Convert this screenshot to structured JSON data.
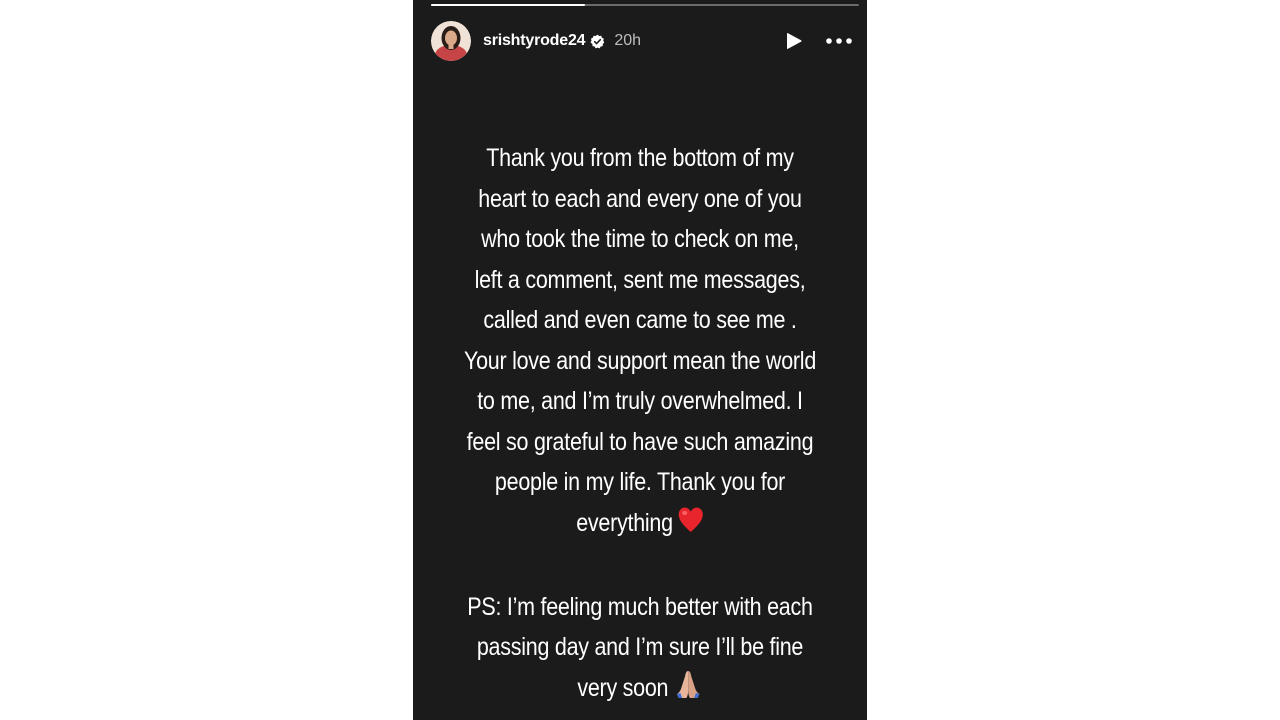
{
  "story": {
    "progress": 0.36,
    "username": "srishtyrode24",
    "timestamp": "20h",
    "verified": true,
    "message_lines": [
      "Thank you from the bottom of my",
      "heart to each and every one of you",
      "who took the time to check on me,",
      "left a comment, sent me messages,",
      "called and even came to see me .",
      "Your love and support mean the world",
      "to me, and I’m truly overwhelmed. I",
      "feel so grateful to have such amazing",
      "people in my life. Thank you for",
      "everything"
    ],
    "ps_lines": [
      "PS: I’m feeling much better with each",
      "passing day and I’m sure I’ll be fine",
      "very soon"
    ],
    "emojis": {
      "heart": "heart-emoji",
      "folded_hands": "folded-hands-emoji"
    }
  },
  "icons": {
    "play": "play-icon",
    "more": "more-options-icon",
    "verified": "verified-badge-icon"
  },
  "colors": {
    "background": "#1b1b1b",
    "text": "#ffffff",
    "timestamp": "#bdbdbd",
    "verified": "#ffffff"
  }
}
